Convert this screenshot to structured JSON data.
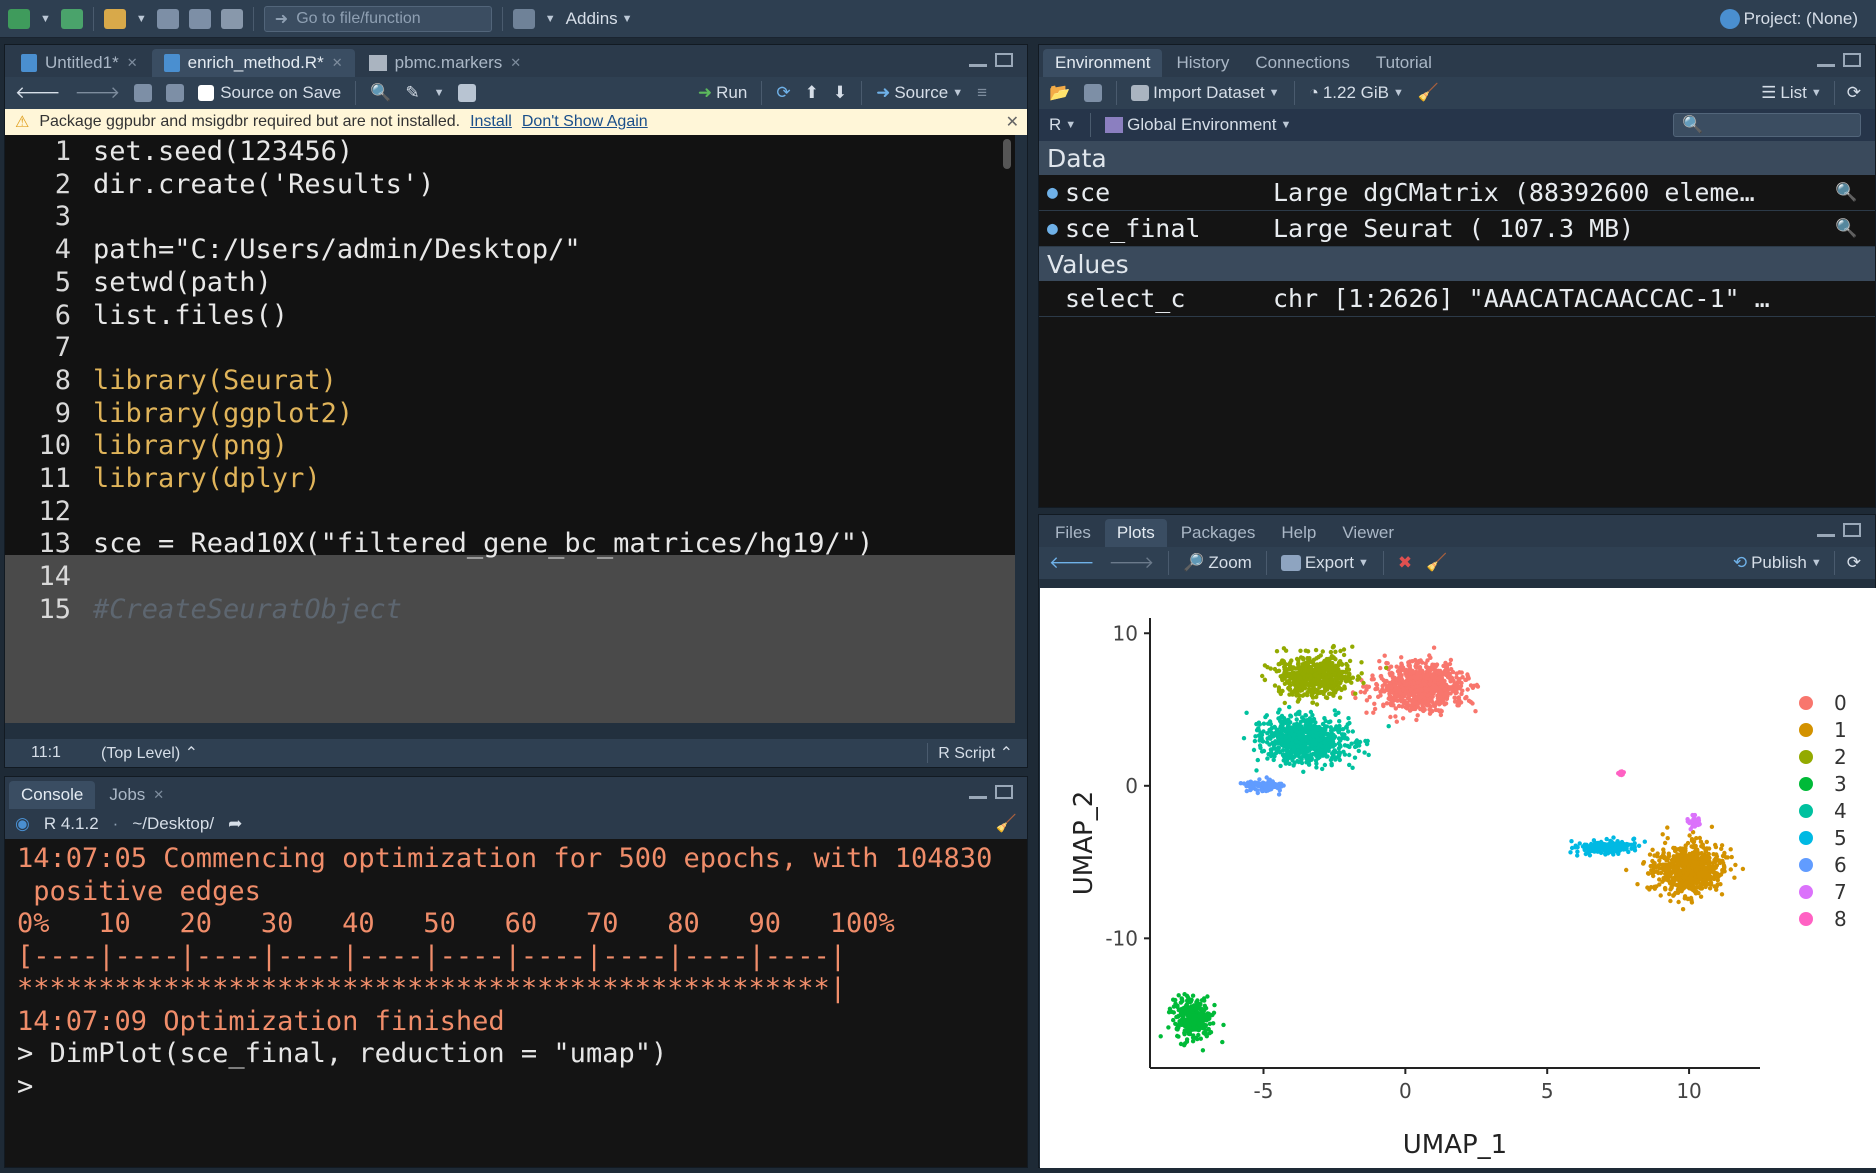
{
  "toolbar": {
    "goto_placeholder": "Go to file/function",
    "addins": "Addins",
    "project": "Project: (None)"
  },
  "editor": {
    "tabs": [
      {
        "label": "Untitled1*"
      },
      {
        "label": "enrich_method.R*"
      },
      {
        "label": "pbmc.markers"
      }
    ],
    "source_on_save": "Source on Save",
    "run": "Run",
    "source": "Source",
    "warning": "Package ggpubr and msigdbr required but are not installed.",
    "install": "Install",
    "dont_show": "Don't Show Again",
    "lines": [
      {
        "n": "1",
        "code": "set.seed(123456)"
      },
      {
        "n": "2",
        "code": "dir.create('Results')"
      },
      {
        "n": "3",
        "code": ""
      },
      {
        "n": "4",
        "code": "path=\"C:/Users/admin/Desktop/\""
      },
      {
        "n": "5",
        "code": "setwd(path)"
      },
      {
        "n": "6",
        "code": "list.files()"
      },
      {
        "n": "7",
        "code": ""
      },
      {
        "n": "8",
        "code": "library(Seurat)"
      },
      {
        "n": "9",
        "code": "library(ggplot2)"
      },
      {
        "n": "10",
        "code": "library(png)"
      },
      {
        "n": "11",
        "code": "library(dplyr)"
      },
      {
        "n": "12",
        "code": ""
      },
      {
        "n": "13",
        "code": "sce = Read10X(\"filtered_gene_bc_matrices/hg19/\")"
      },
      {
        "n": "14",
        "code": ""
      },
      {
        "n": "15",
        "code": "#CreateSeuratObject"
      }
    ],
    "status_pos": "11:1",
    "status_scope": "(Top Level)",
    "status_type": "R Script"
  },
  "console": {
    "tabs": [
      {
        "label": "Console"
      },
      {
        "label": "Jobs"
      }
    ],
    "r_version": "R 4.1.2",
    "path": "~/Desktop/",
    "lines": [
      "14:07:05 Commencing optimization for 500 epochs, with 104830",
      " positive edges",
      "0%   10   20   30   40   50   60   70   80   90   100%",
      "[----|----|----|----|----|----|----|----|----|----|",
      "**************************************************|",
      "14:07:09 Optimization finished"
    ],
    "command": "> DimPlot(sce_final, reduction = \"umap\")",
    "prompt": ">"
  },
  "environment": {
    "tabs": [
      {
        "label": "Environment"
      },
      {
        "label": "History"
      },
      {
        "label": "Connections"
      },
      {
        "label": "Tutorial"
      }
    ],
    "import_dataset": "Import Dataset",
    "memory": "1.22 GiB",
    "list_view": "List",
    "lang": "R",
    "scope": "Global Environment",
    "data_header": "Data",
    "values_header": "Values",
    "data": [
      {
        "name": "sce",
        "value": "Large dgCMatrix (88392600 eleme…"
      },
      {
        "name": "sce_final",
        "value": "Large Seurat ( 107.3 MB)"
      }
    ],
    "values": [
      {
        "name": "select_c",
        "value": "chr [1:2626] \"AAACATACAACCAC-1\" …"
      }
    ]
  },
  "plots": {
    "tabs": [
      {
        "label": "Files"
      },
      {
        "label": "Plots"
      },
      {
        "label": "Packages"
      },
      {
        "label": "Help"
      },
      {
        "label": "Viewer"
      }
    ],
    "zoom": "Zoom",
    "export": "Export",
    "publish": "Publish"
  },
  "colors": {
    "accent": "#4a90d9",
    "warning_bar": "#fff6d8",
    "console_orange": "#f08d6a"
  },
  "chart_data": {
    "type": "scatter",
    "xlabel": "UMAP_1",
    "ylabel": "UMAP_2",
    "xlim": [
      -9,
      12.5
    ],
    "ylim": [
      -18.5,
      11
    ],
    "x_ticks": [
      -5,
      0,
      5,
      10
    ],
    "y_ticks": [
      -10,
      0,
      10
    ],
    "legend_position": "right",
    "series": [
      {
        "name": "0",
        "color": "#F8766D",
        "center": [
          0.5,
          6.5
        ],
        "spread": [
          1.4,
          1.4
        ]
      },
      {
        "name": "1",
        "color": "#D39200",
        "center": [
          10,
          -5.5
        ],
        "spread": [
          1.1,
          1.5
        ]
      },
      {
        "name": "2",
        "color": "#93AA00",
        "center": [
          -3.2,
          7.2
        ],
        "spread": [
          1.2,
          1.2
        ]
      },
      {
        "name": "3",
        "color": "#00BA38",
        "center": [
          -7.5,
          -15.3
        ],
        "spread": [
          0.6,
          1.2
        ]
      },
      {
        "name": "4",
        "color": "#00C19F",
        "center": [
          -3.5,
          3.0
        ],
        "spread": [
          1.4,
          1.3
        ]
      },
      {
        "name": "5",
        "color": "#00B9E3",
        "center": [
          7.0,
          -4.0
        ],
        "spread": [
          1.0,
          0.4
        ]
      },
      {
        "name": "6",
        "color": "#619CFF",
        "center": [
          -5.0,
          0.0
        ],
        "spread": [
          0.6,
          0.4
        ]
      },
      {
        "name": "7",
        "color": "#DB72FB",
        "center": [
          10.2,
          -2.3
        ],
        "spread": [
          0.2,
          0.4
        ]
      },
      {
        "name": "8",
        "color": "#FF61C3",
        "center": [
          7.6,
          0.8
        ],
        "spread": [
          0.1,
          0.1
        ]
      }
    ]
  }
}
